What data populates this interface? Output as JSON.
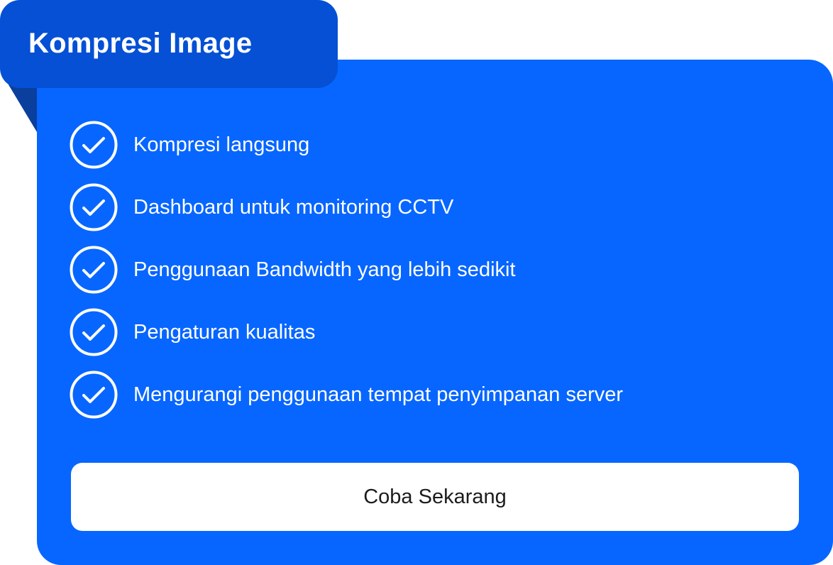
{
  "card": {
    "title": "Kompresi Image",
    "features": [
      {
        "label": "Kompresi langsung",
        "icon": "check-circle-icon"
      },
      {
        "label": "Dashboard untuk monitoring CCTV",
        "icon": "check-circle-icon"
      },
      {
        "label": "Penggunaan Bandwidth yang lebih sedikit",
        "icon": "check-circle-icon"
      },
      {
        "label": "Pengaturan kualitas",
        "icon": "check-circle-icon"
      },
      {
        "label": "Mengurangi penggunaan tempat penyimpanan server",
        "icon": "check-circle-icon"
      }
    ],
    "cta_label": "Coba Sekarang"
  },
  "colors": {
    "card_background": "#0766ff",
    "tab_background": "#0550d4",
    "fold_shadow": "#0a3f9e",
    "text_on_blue": "#ffffff",
    "button_background": "#ffffff",
    "button_text": "#1c1c1c"
  }
}
